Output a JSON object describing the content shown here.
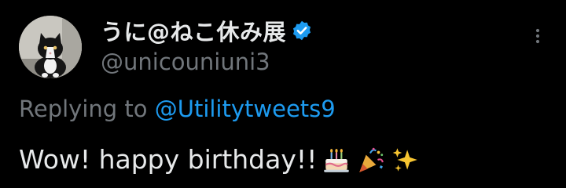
{
  "author": {
    "display_name": "うに@ねこ休み展",
    "handle": "@unicouniuni3",
    "avatar_icon": "cat-avatar",
    "verified_icon": "verified-badge-icon",
    "verified_color": "#1d9bf0"
  },
  "more_icon": "more-options-icon",
  "reply": {
    "prefix": "Replying to ",
    "target": "@Utilitytweets9"
  },
  "tweet": {
    "text": "Wow! happy birthday!!",
    "emojis": [
      "birthday-cake-emoji",
      "party-popper-emoji",
      "sparkles-emoji"
    ]
  },
  "colors": {
    "background": "#000000",
    "primary_text": "#e7e9ea",
    "secondary_text": "#71767b",
    "link": "#1d9bf0"
  }
}
